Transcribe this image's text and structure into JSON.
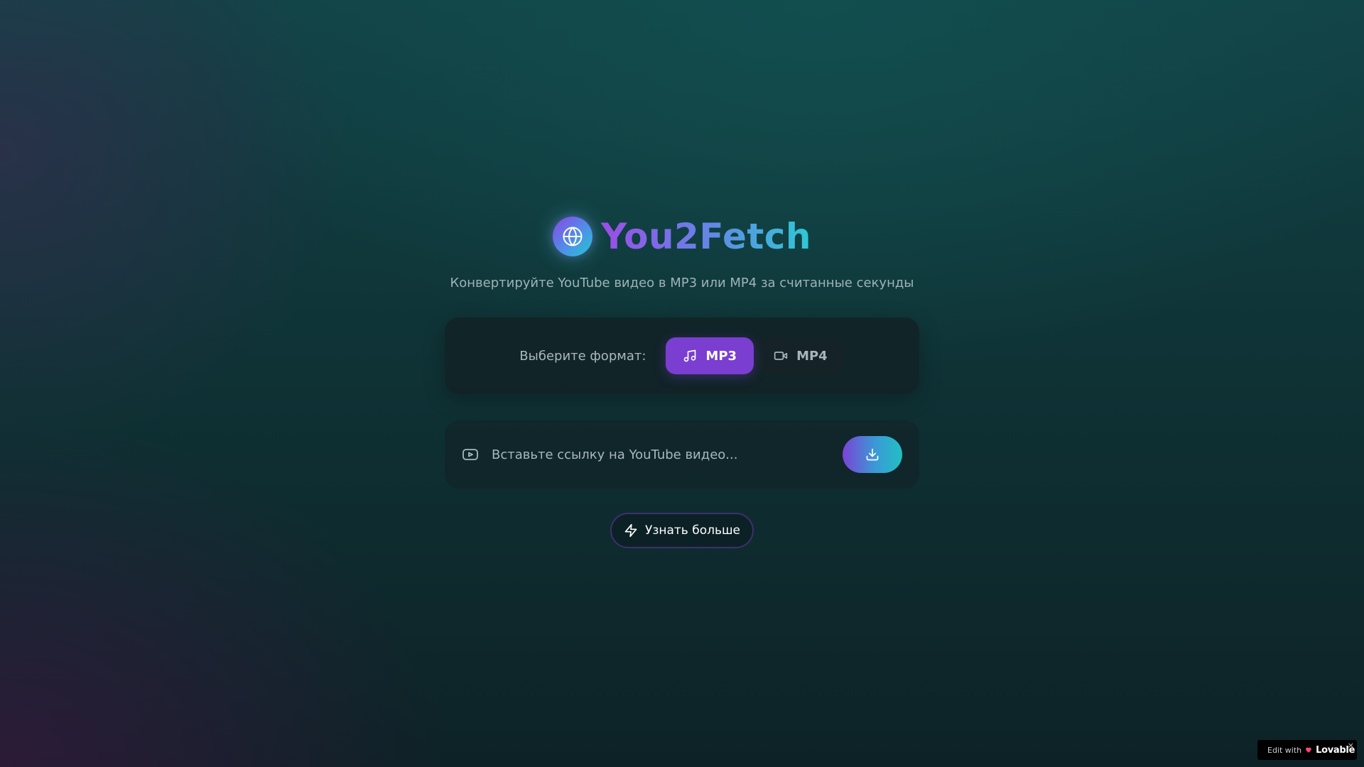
{
  "header": {
    "title": "You2Fetch",
    "subtitle": "Конвертируйте YouTube видео в MP3 или MP4 за считанные секунды",
    "logo_icon": "globe-icon"
  },
  "format_selector": {
    "label": "Выберите формат:",
    "options": [
      {
        "label": "MP3",
        "icon": "headphones-icon",
        "selected": true
      },
      {
        "label": "MP4",
        "icon": "video-camera-icon",
        "selected": false
      }
    ]
  },
  "url_input": {
    "placeholder": "Вставьте ссылку на YouTube видео...",
    "value": "",
    "icon": "youtube-icon",
    "submit_icon": "download-icon"
  },
  "learn_more": {
    "label": "Узнать больше",
    "icon": "lightning-icon"
  },
  "badge": {
    "edit_text": "Edit with",
    "brand": "Lovable",
    "close": "×"
  },
  "colors": {
    "accent_purple": "#7a3ed0",
    "accent_cyan": "#22c9cf",
    "background": "#0f3336"
  }
}
